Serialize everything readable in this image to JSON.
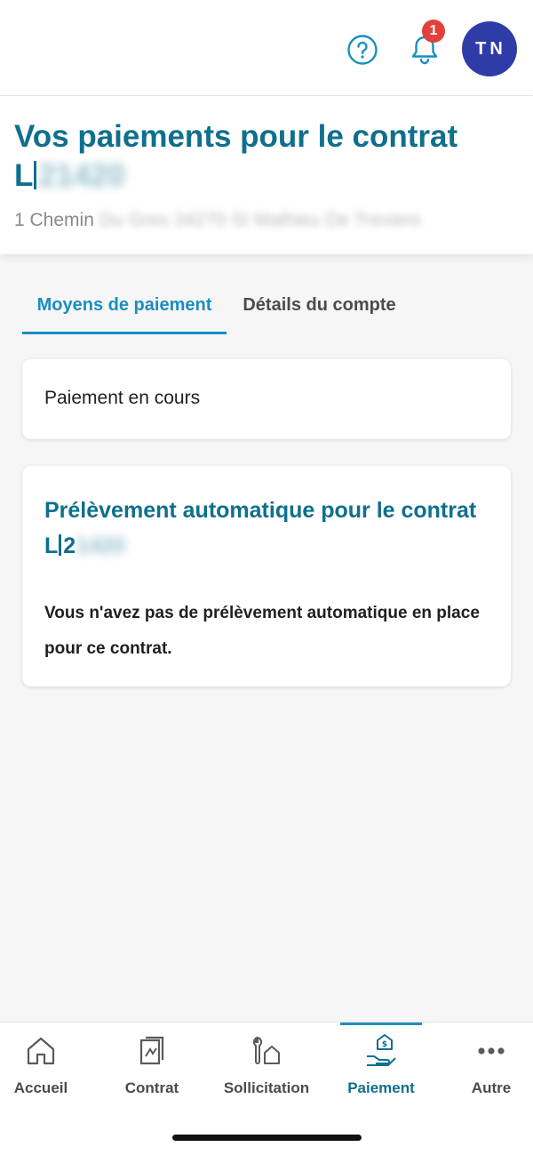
{
  "topbar": {
    "notification_count": "1",
    "avatar_initials": "TN"
  },
  "header": {
    "title_line1": "Vos paiements pour le contrat",
    "contract_prefix": "L",
    "contract_blurred": "21420",
    "address_prefix": "1 Chemin",
    "address_blurred": "Du Gres 34270 St Mathieu De Treviers"
  },
  "tabs": [
    {
      "label": "Moyens de paiement",
      "active": true
    },
    {
      "label": "Détails du compte",
      "active": false
    }
  ],
  "payment_status": {
    "label": "Paiement en cours"
  },
  "direct_debit": {
    "title_line1": "Prélèvement automatique pour le contrat",
    "contract_prefix": "L",
    "contract_visible": "2",
    "contract_blurred": "1420",
    "message": "Vous n'avez pas de prélèvement automatique en place pour ce contrat."
  },
  "bottom_nav": [
    {
      "label": "Accueil",
      "icon": "home-icon"
    },
    {
      "label": "Contrat",
      "icon": "contract-icon"
    },
    {
      "label": "Sollicitation",
      "icon": "request-icon"
    },
    {
      "label": "Paiement",
      "icon": "payment-icon",
      "active": true
    },
    {
      "label": "Autre",
      "icon": "more-icon"
    }
  ],
  "colors": {
    "primary": "#0f6f8d",
    "accent": "#1a8ec0",
    "avatar": "#2f3ca8",
    "badge": "#e2403a"
  }
}
